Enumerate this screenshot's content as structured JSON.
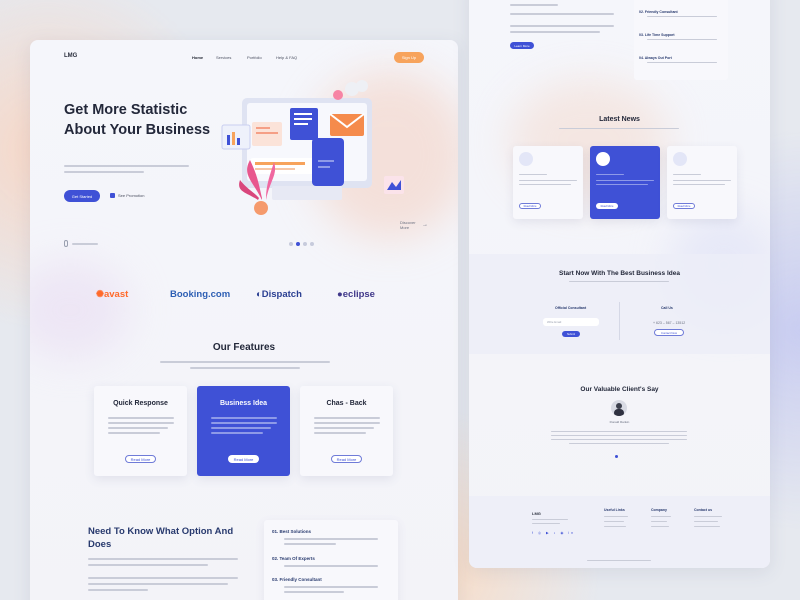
{
  "left": {
    "logo": "LMG",
    "nav": [
      "Home",
      "Services",
      "Portfolio",
      "Help & FAQ"
    ],
    "signup": "Sign Up",
    "hero_title": "Get More Statistic About Your Business",
    "hero_primary": "Get Started",
    "hero_secondary": "See Promotion",
    "scroll_label": "Discover More",
    "brands": [
      "avast",
      "Booking.com",
      "Dispatch",
      "eclipse"
    ],
    "features_title": "Our Features",
    "feature_cards": [
      {
        "title": "Quick Response",
        "button": "Read More"
      },
      {
        "title": "Business Idea",
        "button": "Read More"
      },
      {
        "title": "Chas - Back",
        "button": "Read More"
      }
    ],
    "need_title": "Need To Know What Option And Does",
    "options": [
      "01. Best Solutions",
      "02. Team Of Experts",
      "03. Friendly Consultant"
    ]
  },
  "right": {
    "top_list": [
      "02. Friendly Consultant",
      "03. Life Time Support",
      "04. Always Out Port"
    ],
    "top_button": "Learn More",
    "news_title": "Latest News",
    "news_button": "Read More",
    "start_title": "Start Now With The Best Business Idea",
    "start_left_title": "Official Consultant",
    "start_input_placeholder": "Write Email",
    "start_submit": "Submit",
    "start_right_title": "Call Us",
    "start_phone": "+ 623 – 567 – 13512",
    "start_right_button": "Contact Now",
    "testimonial_title": "Our Valuable Client's Say",
    "client_name": "Ronald Rankin",
    "footer_logo": "LMG",
    "footer_cols": [
      "Useful Links",
      "Company",
      "Contact us"
    ]
  },
  "colors": {
    "primary": "#3f51d6",
    "accent": "#f7a35c",
    "avast": "#ff6a2b",
    "booking": "#2d5fb4",
    "dispatch": "#2a3f92",
    "eclipse": "#40388a"
  }
}
